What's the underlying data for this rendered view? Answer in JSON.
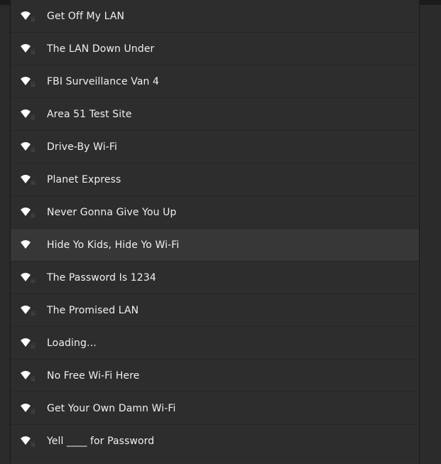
{
  "networks": [
    {
      "ssid": "Get Off My LAN",
      "secured": true
    },
    {
      "ssid": "The LAN Down Under",
      "secured": true
    },
    {
      "ssid": "FBI Surveillance Van 4",
      "secured": true
    },
    {
      "ssid": "Area 51 Test Site",
      "secured": true
    },
    {
      "ssid": "Drive-By Wi-Fi",
      "secured": true
    },
    {
      "ssid": "Planet Express",
      "secured": true
    },
    {
      "ssid": "Never Gonna Give You Up",
      "secured": true
    },
    {
      "ssid": "Hide Yo Kids, Hide Yo Wi-Fi",
      "secured": false,
      "selected": true
    },
    {
      "ssid": "The Password Is 1234",
      "secured": true
    },
    {
      "ssid": "The Promised LAN",
      "secured": true
    },
    {
      "ssid": "Loading…",
      "secured": true
    },
    {
      "ssid": "No Free Wi-Fi Here",
      "secured": true
    },
    {
      "ssid": "Get Your Own Damn Wi-Fi",
      "secured": true
    },
    {
      "ssid": "Yell ____ for Password",
      "secured": true
    }
  ],
  "icons": {
    "signal": "wifi-signal-icon",
    "lock": "lock-icon"
  },
  "colors": {
    "background": "#2d2d2d",
    "selected_row": "#373737",
    "text": "#f0f0f0"
  }
}
